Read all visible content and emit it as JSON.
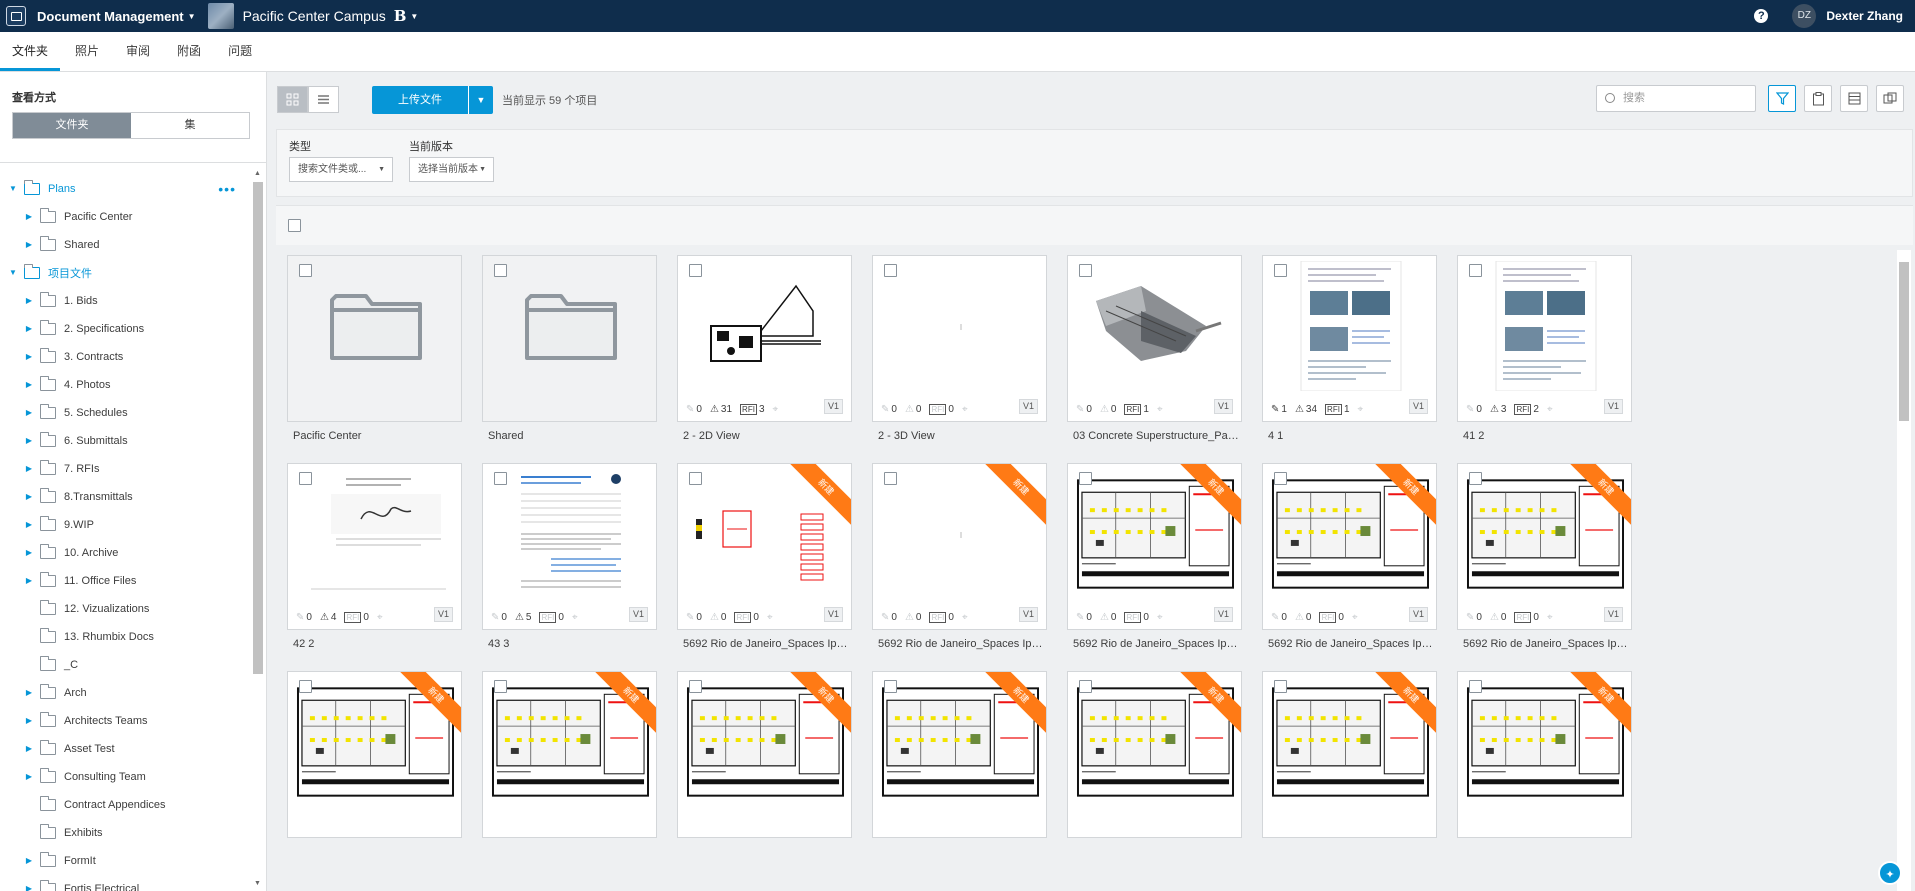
{
  "topbar": {
    "app_title": "Document Management",
    "project_name": "Pacific Center Campus",
    "project_badge": "B",
    "help_label": "?",
    "user_initials": "DZ",
    "user_name": "Dexter Zhang"
  },
  "tabs": [
    "文件夹",
    "照片",
    "审阅",
    "附函",
    "问题"
  ],
  "sidebar": {
    "view_label": "查看方式",
    "view_options": [
      "文件夹",
      "集"
    ],
    "tree": [
      {
        "label": "Plans",
        "level": 0,
        "expanded": true,
        "root": true
      },
      {
        "label": "Pacific Center",
        "level": 1,
        "expandable": true
      },
      {
        "label": "Shared",
        "level": 1,
        "expandable": true
      },
      {
        "label": "项目文件",
        "level": 0,
        "expanded": true,
        "root": true
      },
      {
        "label": "1. Bids",
        "level": 1,
        "expandable": true
      },
      {
        "label": "2. Specifications",
        "level": 1,
        "expandable": true
      },
      {
        "label": "3. Contracts",
        "level": 1,
        "expandable": true
      },
      {
        "label": "4. Photos",
        "level": 1,
        "expandable": true
      },
      {
        "label": "5. Schedules",
        "level": 1,
        "expandable": true
      },
      {
        "label": "6. Submittals",
        "level": 1,
        "expandable": true
      },
      {
        "label": "7. RFIs",
        "level": 1,
        "expandable": true
      },
      {
        "label": "8.Transmittals",
        "level": 1,
        "expandable": true
      },
      {
        "label": "9.WIP",
        "level": 1,
        "expandable": true
      },
      {
        "label": "10. Archive",
        "level": 1,
        "expandable": true
      },
      {
        "label": "11. Office Files",
        "level": 1,
        "expandable": true
      },
      {
        "label": "12. Vizualizations",
        "level": 1,
        "expandable": false
      },
      {
        "label": "13. Rhumbix Docs",
        "level": 1,
        "expandable": false
      },
      {
        "label": "_C",
        "level": 1,
        "expandable": false
      },
      {
        "label": "Arch",
        "level": 1,
        "expandable": true
      },
      {
        "label": "Architects Teams",
        "level": 1,
        "expandable": true
      },
      {
        "label": "Asset Test",
        "level": 1,
        "expandable": true
      },
      {
        "label": "Consulting Team",
        "level": 1,
        "expandable": true
      },
      {
        "label": "Contract Appendices",
        "level": 1,
        "expandable": false
      },
      {
        "label": "Exhibits",
        "level": 1,
        "expandable": false
      },
      {
        "label": "FormIt",
        "level": 1,
        "expandable": true
      },
      {
        "label": "Fortis Electrical",
        "level": 1,
        "expandable": true
      }
    ]
  },
  "toolbar": {
    "upload_label": "上传文件",
    "count_text": "当前显示 59 个项目",
    "search_placeholder": "搜索"
  },
  "filters": {
    "type_label": "类型",
    "type_value": "搜索文件类或...",
    "version_label": "当前版本",
    "version_value": "选择当前版本"
  },
  "new_badge": "新建",
  "cards": [
    {
      "name": "Pacific Center",
      "kind": "folder"
    },
    {
      "name": "Shared",
      "kind": "folder"
    },
    {
      "name": "2 - 2D View",
      "kind": "drawing2d",
      "markups": "0",
      "issues": "31",
      "rfis": "3",
      "ver": "V1",
      "new": false
    },
    {
      "name": "2 - 3D View",
      "kind": "blank",
      "markups": "0",
      "issues": "0",
      "rfis": "0",
      "ver": "V1",
      "new": false
    },
    {
      "name": "03 Concrete Superstructure_PacificCent...",
      "kind": "model3d",
      "markups": "0",
      "issues": "0",
      "rfis": "1",
      "ver": "V1",
      "new": false
    },
    {
      "name": "4 1",
      "kind": "doc",
      "markups": "1",
      "issues": "34",
      "rfis": "1",
      "ver": "V1",
      "new": false
    },
    {
      "name": "41 2",
      "kind": "doc",
      "markups": "0",
      "issues": "3",
      "rfis": "2",
      "ver": "V1",
      "new": false
    },
    {
      "name": "42 2",
      "kind": "letter",
      "markups": "0",
      "issues": "4",
      "rfis": "0",
      "ver": "V1",
      "new": false
    },
    {
      "name": "43 3",
      "kind": "form",
      "markups": "0",
      "issues": "5",
      "rfis": "0",
      "ver": "V1",
      "new": false
    },
    {
      "name": "5692 Rio de Janeiro_Spaces Ipanema_0...",
      "kind": "redsheet",
      "markups": "0",
      "issues": "0",
      "rfis": "0",
      "ver": "V1",
      "new": true
    },
    {
      "name": "5692 Rio de Janeiro_Spaces Ipanema_0...",
      "kind": "blank",
      "markups": "0",
      "issues": "0",
      "rfis": "0",
      "ver": "V1",
      "new": true
    },
    {
      "name": "5692 Rio de Janeiro_Spaces Ipanema_0...",
      "kind": "plan",
      "markups": "0",
      "issues": "0",
      "rfis": "0",
      "ver": "V1",
      "new": true
    },
    {
      "name": "5692 Rio de Janeiro_Spaces Ipanema_0...",
      "kind": "plan",
      "markups": "0",
      "issues": "0",
      "rfis": "0",
      "ver": "V1",
      "new": true
    },
    {
      "name": "5692 Rio de Janeiro_Spaces Ipanema_0...",
      "kind": "plan",
      "markups": "0",
      "issues": "0",
      "rfis": "0",
      "ver": "V1",
      "new": true
    },
    {
      "name": "",
      "kind": "plan",
      "new": true
    },
    {
      "name": "",
      "kind": "plan",
      "new": true
    },
    {
      "name": "",
      "kind": "plan",
      "new": true
    },
    {
      "name": "",
      "kind": "plan",
      "new": true
    },
    {
      "name": "",
      "kind": "plan",
      "new": true
    },
    {
      "name": "",
      "kind": "plan",
      "new": true
    },
    {
      "name": "",
      "kind": "plan",
      "new": true
    }
  ],
  "colors": {
    "topbar": "#0f2d4c",
    "accent": "#0696d7",
    "new_ribbon": "#ff7a15"
  }
}
